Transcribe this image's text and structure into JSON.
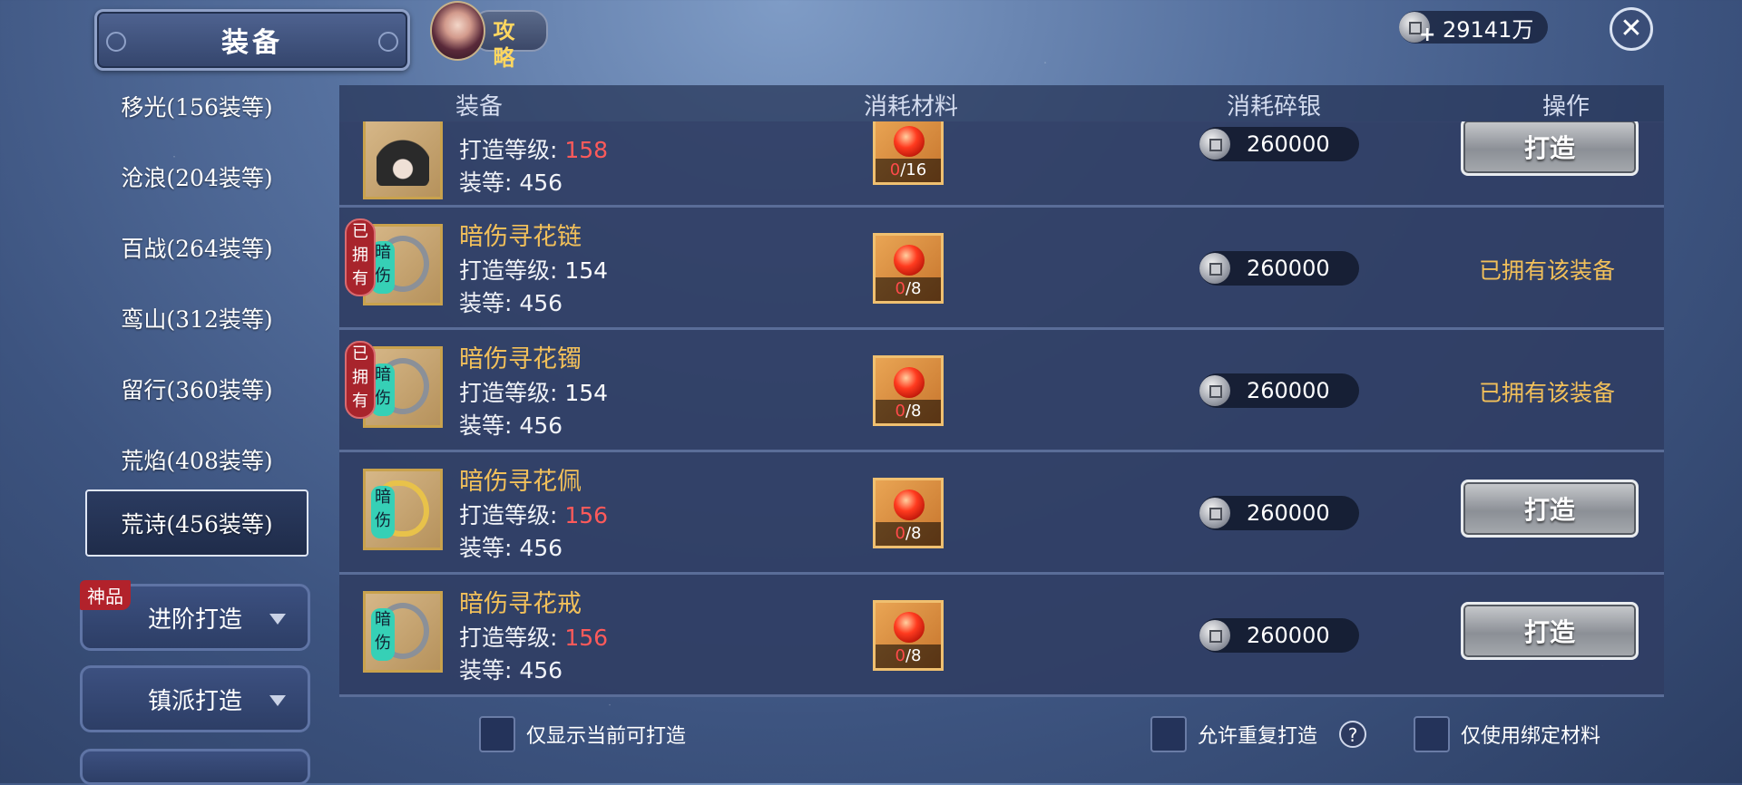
{
  "header": {
    "title": "装备",
    "guide_label": "攻略",
    "currency_value": "29141万"
  },
  "sidebar": {
    "items": [
      {
        "label": "移光(156装等)"
      },
      {
        "label": "沧浪(204装等)"
      },
      {
        "label": "百战(264装等)"
      },
      {
        "label": "鸾山(312装等)"
      },
      {
        "label": "留行(360装等)"
      },
      {
        "label": "荒焰(408装等)"
      },
      {
        "label": "荒诗(456装等)",
        "active": true
      }
    ],
    "advanced_badge": "神品",
    "advanced_label": "进阶打造",
    "faction_label": "镇派打造"
  },
  "table": {
    "headers": [
      "装备",
      "消耗材料",
      "消耗碎银",
      "操作"
    ],
    "level_prefix": "打造等级: ",
    "gear_prefix": "装等: ",
    "owned_tag": "已拥有",
    "type_tag": "暗伤",
    "rows": [
      {
        "name": "",
        "level": "158",
        "level_red": true,
        "gear": "456",
        "mat_have": "0",
        "mat_need": "/16",
        "silver": "260000",
        "action": "打造",
        "owned": false
      },
      {
        "name": "暗伤寻花链",
        "level": "154",
        "level_red": false,
        "gear": "456",
        "mat_have": "0",
        "mat_need": "/8",
        "silver": "260000",
        "action": "已拥有该装备",
        "owned": true
      },
      {
        "name": "暗伤寻花镯",
        "level": "154",
        "level_red": false,
        "gear": "456",
        "mat_have": "0",
        "mat_need": "/8",
        "silver": "260000",
        "action": "已拥有该装备",
        "owned": true
      },
      {
        "name": "暗伤寻花佩",
        "level": "156",
        "level_red": true,
        "gear": "456",
        "mat_have": "0",
        "mat_need": "/8",
        "silver": "260000",
        "action": "打造",
        "owned": false
      },
      {
        "name": "暗伤寻花戒",
        "level": "156",
        "level_red": true,
        "gear": "456",
        "mat_have": "0",
        "mat_need": "/8",
        "silver": "260000",
        "action": "打造",
        "owned": false
      }
    ]
  },
  "footer": {
    "only_current": "仅显示当前可打造",
    "allow_repeat": "允许重复打造",
    "help": "?",
    "bound_only": "仅使用绑定材料"
  }
}
